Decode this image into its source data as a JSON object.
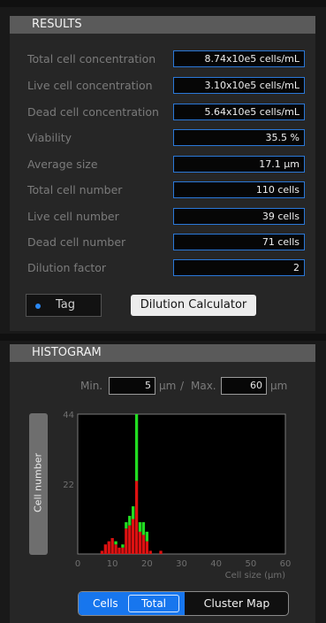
{
  "results": {
    "title": "RESULTS",
    "rows": [
      {
        "label": "Total cell concentration",
        "value": "8.74x10e5 cells/mL"
      },
      {
        "label": "Live cell concentration",
        "value": "3.10x10e5 cells/mL"
      },
      {
        "label": "Dead cell concentration",
        "value": "5.64x10e5 cells/mL"
      },
      {
        "label": "Viability",
        "value": "35.5 %"
      },
      {
        "label": "Average size",
        "value": "17.1 µm"
      },
      {
        "label": "Total cell number",
        "value": "110 cells"
      },
      {
        "label": "Live cell number",
        "value": "39 cells"
      },
      {
        "label": "Dead cell number",
        "value": "71 cells"
      },
      {
        "label": "Dilution factor",
        "value": "2"
      }
    ],
    "tag_label": "Tag",
    "dilution_button": "Dilution Calculator"
  },
  "histogram": {
    "title": "HISTOGRAM",
    "min_label": "Min.",
    "min_value": "5",
    "max_label": "Max.",
    "max_value": "60",
    "unit": "µm",
    "separator": "/",
    "y_axis_button": "Cell number"
  },
  "toggle": {
    "cells_label": "Cells",
    "total_label": "Total",
    "cluster_label": "Cluster Map"
  },
  "colors": {
    "accent": "#1776ee",
    "live": "#22dd22",
    "dead": "#dd1111"
  },
  "chart_data": {
    "type": "bar",
    "stacked": true,
    "xlabel": "Cell size (µm)",
    "ylabel": "Cell number",
    "xlim": [
      0,
      60
    ],
    "ylim": [
      0,
      44
    ],
    "x_ticks": [
      0,
      10,
      20,
      30,
      40,
      50,
      60
    ],
    "y_ticks": [
      22,
      44
    ],
    "x": [
      7,
      8,
      9,
      10,
      11,
      12,
      13,
      14,
      15,
      16,
      17,
      18,
      19,
      20,
      21,
      24
    ],
    "series": [
      {
        "name": "Dead",
        "color": "#dd1111",
        "values": [
          1,
          3,
          4,
          5,
          3,
          2,
          2,
          8,
          9,
          11,
          23,
          7,
          6,
          4,
          1,
          1
        ]
      },
      {
        "name": "Live",
        "color": "#22dd22",
        "values": [
          0,
          0,
          0,
          0,
          1,
          0,
          1,
          2,
          3,
          4,
          21,
          3,
          4,
          3,
          0,
          0
        ]
      }
    ]
  }
}
